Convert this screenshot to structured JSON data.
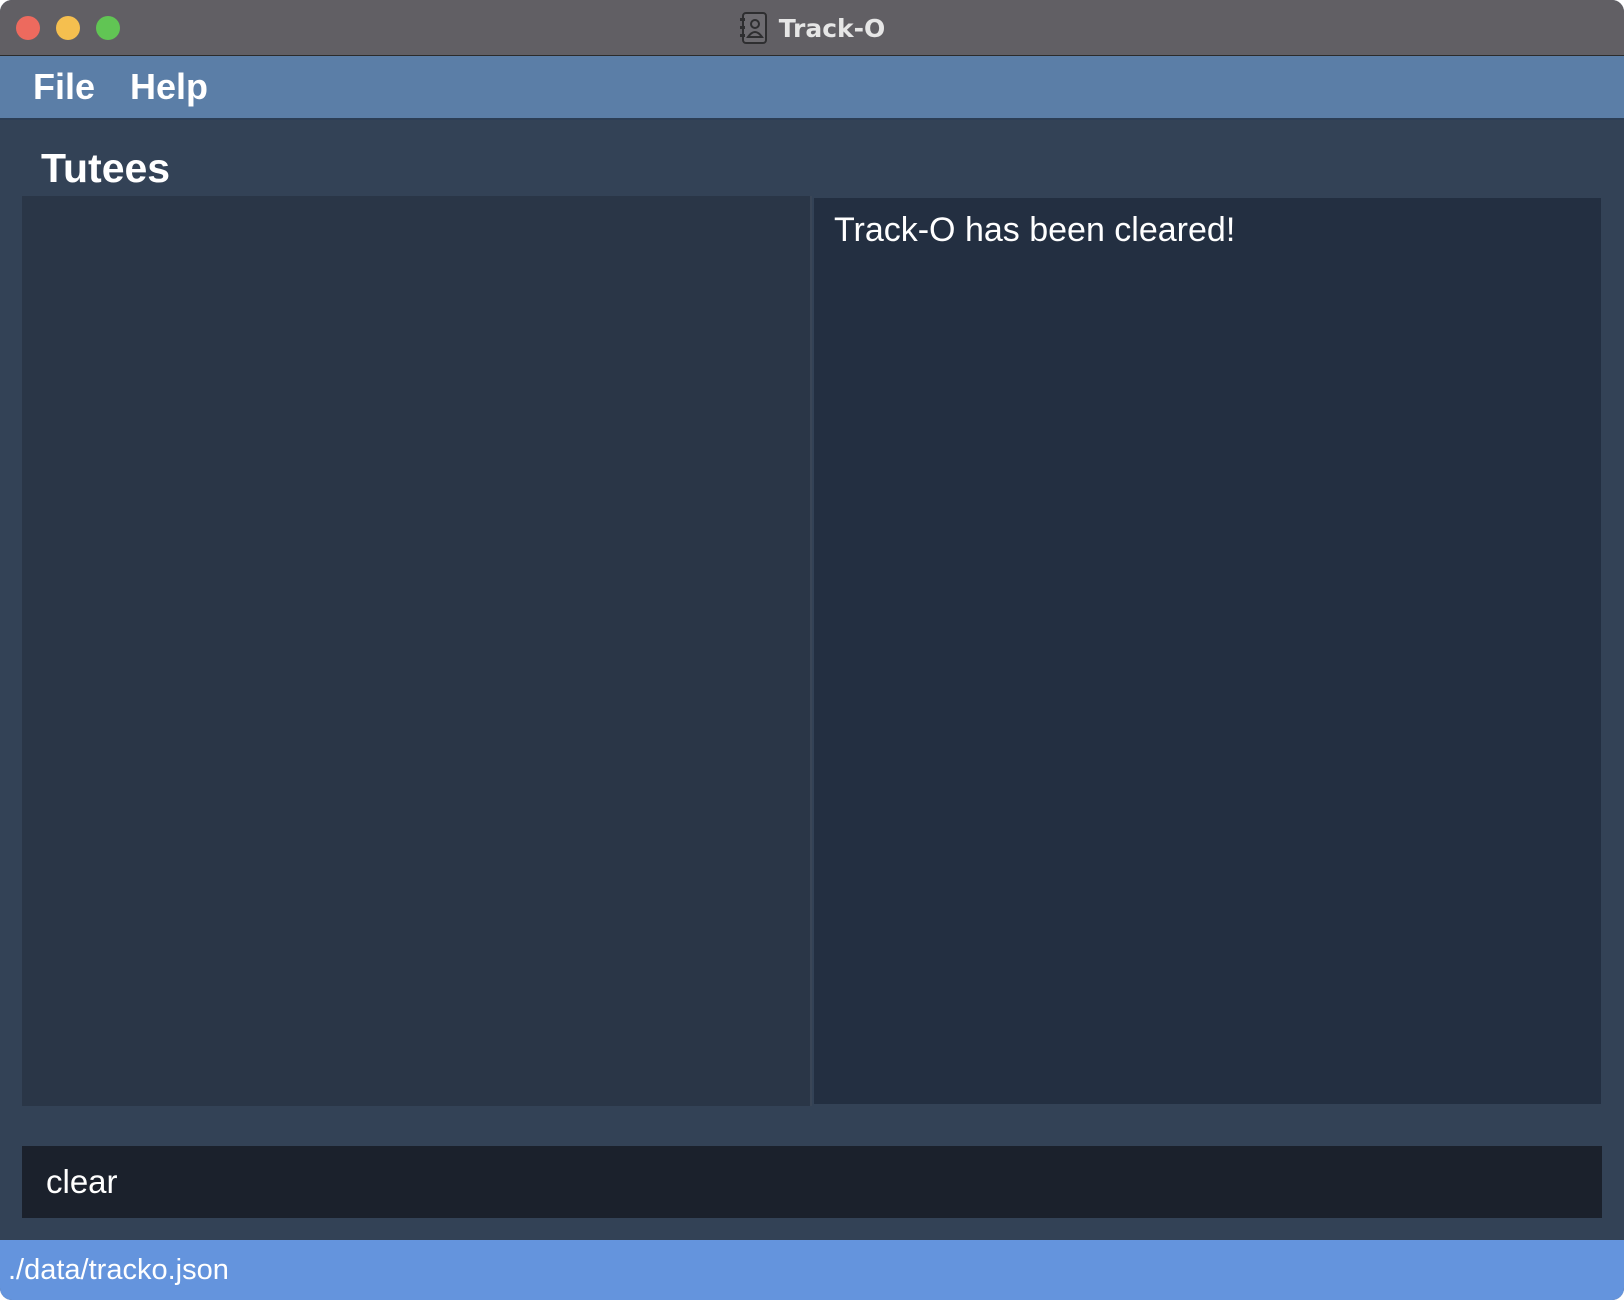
{
  "window": {
    "title": "Track-O",
    "app_icon": "address-book-icon"
  },
  "menu": {
    "items": [
      {
        "label": "File"
      },
      {
        "label": "Help"
      }
    ]
  },
  "main": {
    "section_title": "Tutees",
    "result_message": "Track-O has been cleared!"
  },
  "command": {
    "value": "clear"
  },
  "status": {
    "file_path": "./data/tracko.json"
  },
  "colors": {
    "titlebar": "#615f64",
    "menubar": "#5b7ea7",
    "background": "#334256",
    "list_panel": "#2a3647",
    "result_panel": "#232f41",
    "command_box": "#1b212c",
    "statusbar": "#6494dd"
  }
}
